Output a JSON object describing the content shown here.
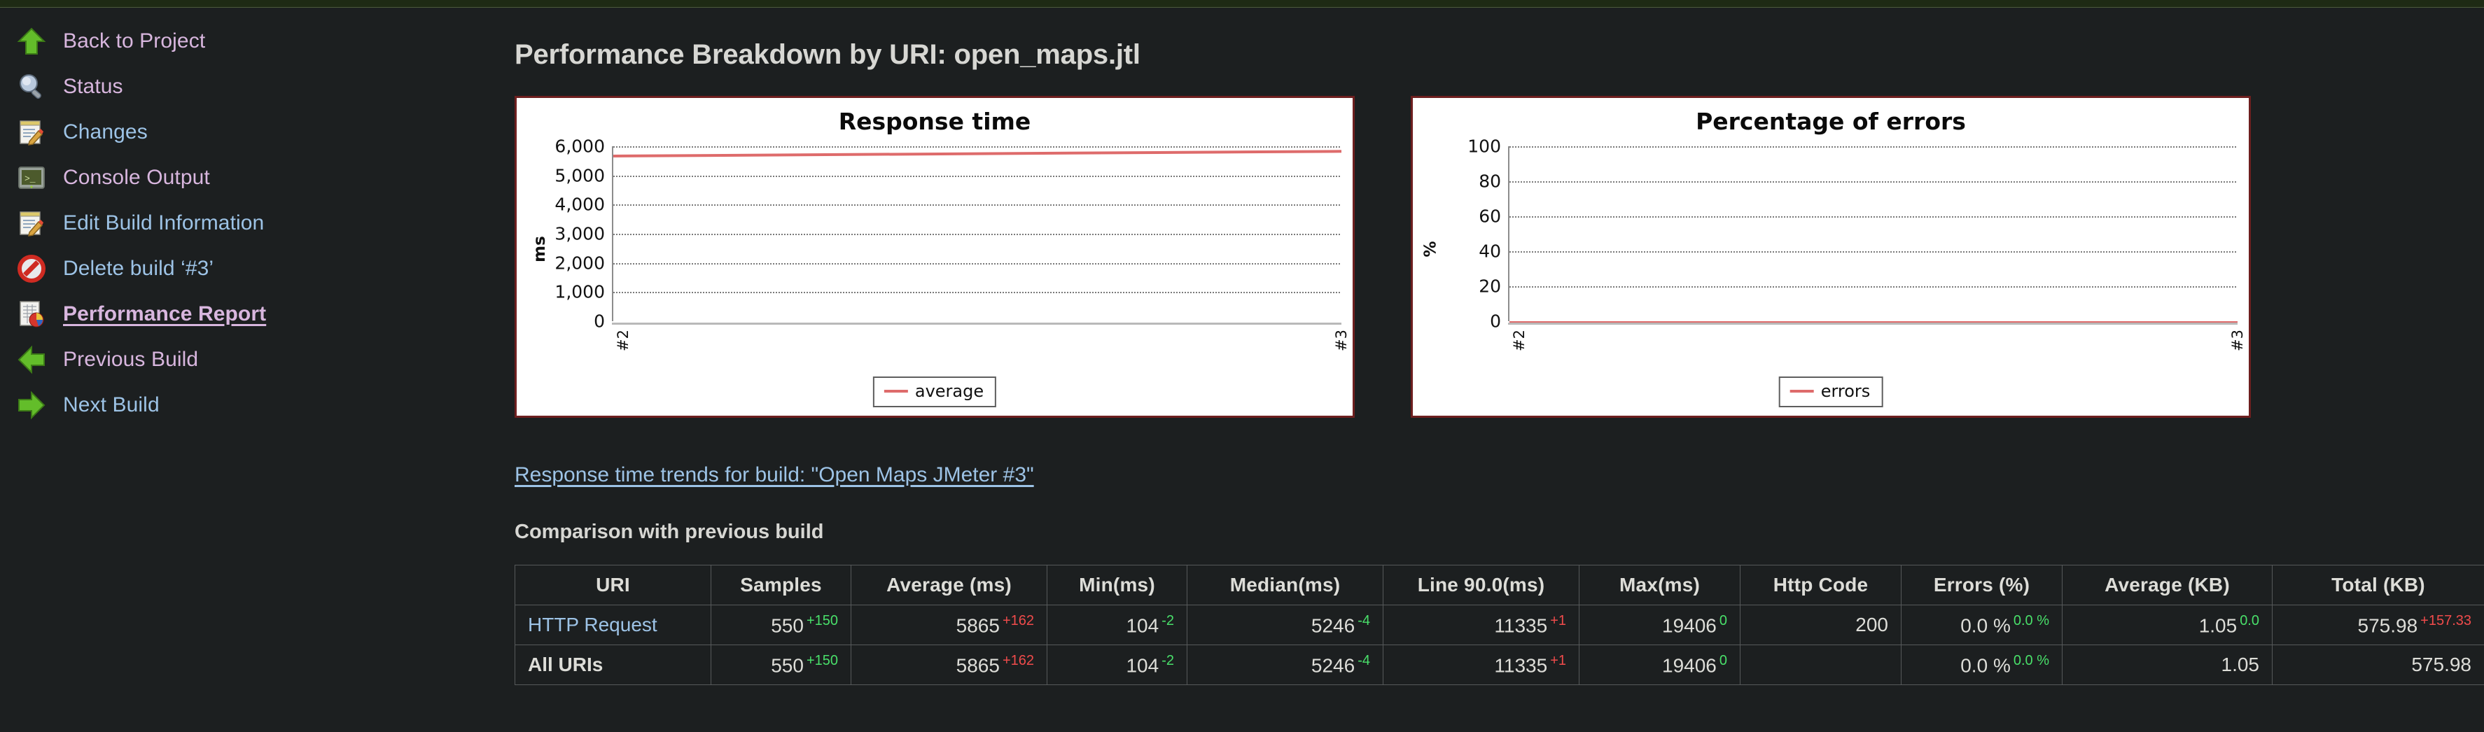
{
  "sidebar": {
    "items": [
      {
        "label": "Back to Project",
        "icon": "up-arrow-icon",
        "state": "visited",
        "current": false
      },
      {
        "label": "Status",
        "icon": "magnifier-icon",
        "state": "visited",
        "current": false
      },
      {
        "label": "Changes",
        "icon": "notepad-pencil-icon",
        "state": "new",
        "current": false
      },
      {
        "label": "Console Output",
        "icon": "terminal-icon",
        "state": "visited",
        "current": false
      },
      {
        "label": "Edit Build Information",
        "icon": "notepad-pencil-icon",
        "state": "new",
        "current": false
      },
      {
        "label": "Delete build ‘#3’",
        "icon": "no-entry-icon",
        "state": "new",
        "current": false
      },
      {
        "label": "Performance Report",
        "icon": "report-chart-icon",
        "state": "visited",
        "current": true
      },
      {
        "label": "Previous Build",
        "icon": "left-arrow-icon",
        "state": "visited",
        "current": false
      },
      {
        "label": "Next Build",
        "icon": "right-arrow-icon",
        "state": "new",
        "current": false
      }
    ]
  },
  "main": {
    "page_title": "Performance Breakdown by URI: open_maps.jtl",
    "trend_link": "Response time trends for build: \"Open Maps JMeter #3\"",
    "section_heading": "Comparison with previous build"
  },
  "chart_data": [
    {
      "type": "line",
      "title": "Response time",
      "xlabel": "",
      "ylabel": "ms",
      "categories": [
        "#2",
        "#3"
      ],
      "series": [
        {
          "name": "average",
          "values": [
            5703,
            5865
          ],
          "color": "#de6b6b"
        }
      ],
      "ylim": [
        0,
        6000
      ],
      "yticks": [
        "0",
        "1,000",
        "2,000",
        "3,000",
        "4,000",
        "5,000",
        "6,000"
      ],
      "grid": true,
      "legend": "bottom"
    },
    {
      "type": "line",
      "title": "Percentage of errors",
      "xlabel": "",
      "ylabel": "%",
      "categories": [
        "#2",
        "#3"
      ],
      "series": [
        {
          "name": "errors",
          "values": [
            0.0,
            0.0
          ],
          "color": "#de6b6b"
        }
      ],
      "ylim": [
        0,
        100
      ],
      "yticks": [
        "0",
        "20",
        "40",
        "60",
        "80",
        "100"
      ],
      "grid": true,
      "legend": "bottom"
    }
  ],
  "table": {
    "columns": [
      "URI",
      "Samples",
      "Average (ms)",
      "Min(ms)",
      "Median(ms)",
      "Line 90.0(ms)",
      "Max(ms)",
      "Http Code",
      "Errors (%)",
      "Average (KB)",
      "Total (KB)"
    ],
    "rows": [
      {
        "uri": "HTTP Request",
        "uri_is_link": true,
        "samples": {
          "value": "550",
          "delta": "+150",
          "dir": "down"
        },
        "average_ms": {
          "value": "5865",
          "delta": "+162",
          "dir": "up"
        },
        "min_ms": {
          "value": "104",
          "delta": "-2",
          "dir": "down"
        },
        "median_ms": {
          "value": "5246",
          "delta": "-4",
          "dir": "down"
        },
        "line90_ms": {
          "value": "11335",
          "delta": "+1",
          "dir": "up"
        },
        "max_ms": {
          "value": "19406",
          "delta": "0",
          "dir": "flat"
        },
        "http_code": {
          "value": "200",
          "delta": "",
          "dir": ""
        },
        "errors_pct": {
          "value": "0.0 %",
          "delta": "0.0 %",
          "dir": "flat"
        },
        "average_kb": {
          "value": "1.05",
          "delta": "0.0",
          "dir": "flat"
        },
        "total_kb": {
          "value": "575.98",
          "delta": "+157.33",
          "dir": "up"
        }
      },
      {
        "uri": "All URIs",
        "uri_is_link": false,
        "samples": {
          "value": "550",
          "delta": "+150",
          "dir": "down"
        },
        "average_ms": {
          "value": "5865",
          "delta": "+162",
          "dir": "up"
        },
        "min_ms": {
          "value": "104",
          "delta": "-2",
          "dir": "down"
        },
        "median_ms": {
          "value": "5246",
          "delta": "-4",
          "dir": "down"
        },
        "line90_ms": {
          "value": "11335",
          "delta": "+1",
          "dir": "up"
        },
        "max_ms": {
          "value": "19406",
          "delta": "0",
          "dir": "flat"
        },
        "http_code": {
          "value": "",
          "delta": "",
          "dir": ""
        },
        "errors_pct": {
          "value": "0.0 %",
          "delta": "0.0 %",
          "dir": "flat"
        },
        "average_kb": {
          "value": "1.05",
          "delta": "",
          "dir": ""
        },
        "total_kb": {
          "value": "575.98",
          "delta": "",
          "dir": ""
        }
      }
    ]
  },
  "colors": {
    "background": "#1c1f20",
    "topstrip": "#1e2a14",
    "link_new": "#9dc3e6",
    "link_visited": "#d8b6de",
    "delta_up": "#f04b4b",
    "delta_down": "#49e06a",
    "series": "#de6b6b"
  }
}
